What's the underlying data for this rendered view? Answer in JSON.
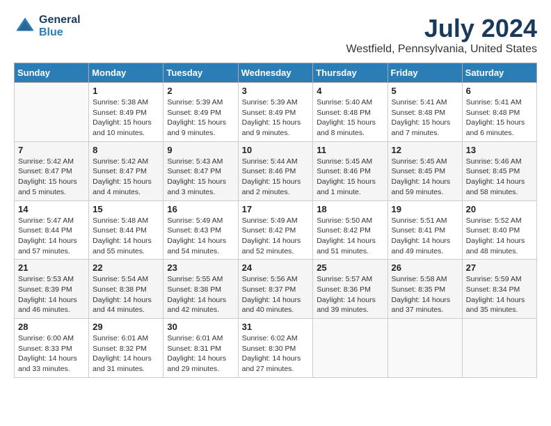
{
  "header": {
    "logo_line1": "General",
    "logo_line2": "Blue",
    "month": "July 2024",
    "location": "Westfield, Pennsylvania, United States"
  },
  "weekdays": [
    "Sunday",
    "Monday",
    "Tuesday",
    "Wednesday",
    "Thursday",
    "Friday",
    "Saturday"
  ],
  "weeks": [
    [
      {
        "day": "",
        "info": ""
      },
      {
        "day": "1",
        "info": "Sunrise: 5:38 AM\nSunset: 8:49 PM\nDaylight: 15 hours\nand 10 minutes."
      },
      {
        "day": "2",
        "info": "Sunrise: 5:39 AM\nSunset: 8:49 PM\nDaylight: 15 hours\nand 9 minutes."
      },
      {
        "day": "3",
        "info": "Sunrise: 5:39 AM\nSunset: 8:49 PM\nDaylight: 15 hours\nand 9 minutes."
      },
      {
        "day": "4",
        "info": "Sunrise: 5:40 AM\nSunset: 8:48 PM\nDaylight: 15 hours\nand 8 minutes."
      },
      {
        "day": "5",
        "info": "Sunrise: 5:41 AM\nSunset: 8:48 PM\nDaylight: 15 hours\nand 7 minutes."
      },
      {
        "day": "6",
        "info": "Sunrise: 5:41 AM\nSunset: 8:48 PM\nDaylight: 15 hours\nand 6 minutes."
      }
    ],
    [
      {
        "day": "7",
        "info": "Sunrise: 5:42 AM\nSunset: 8:47 PM\nDaylight: 15 hours\nand 5 minutes."
      },
      {
        "day": "8",
        "info": "Sunrise: 5:42 AM\nSunset: 8:47 PM\nDaylight: 15 hours\nand 4 minutes."
      },
      {
        "day": "9",
        "info": "Sunrise: 5:43 AM\nSunset: 8:47 PM\nDaylight: 15 hours\nand 3 minutes."
      },
      {
        "day": "10",
        "info": "Sunrise: 5:44 AM\nSunset: 8:46 PM\nDaylight: 15 hours\nand 2 minutes."
      },
      {
        "day": "11",
        "info": "Sunrise: 5:45 AM\nSunset: 8:46 PM\nDaylight: 15 hours\nand 1 minute."
      },
      {
        "day": "12",
        "info": "Sunrise: 5:45 AM\nSunset: 8:45 PM\nDaylight: 14 hours\nand 59 minutes."
      },
      {
        "day": "13",
        "info": "Sunrise: 5:46 AM\nSunset: 8:45 PM\nDaylight: 14 hours\nand 58 minutes."
      }
    ],
    [
      {
        "day": "14",
        "info": "Sunrise: 5:47 AM\nSunset: 8:44 PM\nDaylight: 14 hours\nand 57 minutes."
      },
      {
        "day": "15",
        "info": "Sunrise: 5:48 AM\nSunset: 8:44 PM\nDaylight: 14 hours\nand 55 minutes."
      },
      {
        "day": "16",
        "info": "Sunrise: 5:49 AM\nSunset: 8:43 PM\nDaylight: 14 hours\nand 54 minutes."
      },
      {
        "day": "17",
        "info": "Sunrise: 5:49 AM\nSunset: 8:42 PM\nDaylight: 14 hours\nand 52 minutes."
      },
      {
        "day": "18",
        "info": "Sunrise: 5:50 AM\nSunset: 8:42 PM\nDaylight: 14 hours\nand 51 minutes."
      },
      {
        "day": "19",
        "info": "Sunrise: 5:51 AM\nSunset: 8:41 PM\nDaylight: 14 hours\nand 49 minutes."
      },
      {
        "day": "20",
        "info": "Sunrise: 5:52 AM\nSunset: 8:40 PM\nDaylight: 14 hours\nand 48 minutes."
      }
    ],
    [
      {
        "day": "21",
        "info": "Sunrise: 5:53 AM\nSunset: 8:39 PM\nDaylight: 14 hours\nand 46 minutes."
      },
      {
        "day": "22",
        "info": "Sunrise: 5:54 AM\nSunset: 8:38 PM\nDaylight: 14 hours\nand 44 minutes."
      },
      {
        "day": "23",
        "info": "Sunrise: 5:55 AM\nSunset: 8:38 PM\nDaylight: 14 hours\nand 42 minutes."
      },
      {
        "day": "24",
        "info": "Sunrise: 5:56 AM\nSunset: 8:37 PM\nDaylight: 14 hours\nand 40 minutes."
      },
      {
        "day": "25",
        "info": "Sunrise: 5:57 AM\nSunset: 8:36 PM\nDaylight: 14 hours\nand 39 minutes."
      },
      {
        "day": "26",
        "info": "Sunrise: 5:58 AM\nSunset: 8:35 PM\nDaylight: 14 hours\nand 37 minutes."
      },
      {
        "day": "27",
        "info": "Sunrise: 5:59 AM\nSunset: 8:34 PM\nDaylight: 14 hours\nand 35 minutes."
      }
    ],
    [
      {
        "day": "28",
        "info": "Sunrise: 6:00 AM\nSunset: 8:33 PM\nDaylight: 14 hours\nand 33 minutes."
      },
      {
        "day": "29",
        "info": "Sunrise: 6:01 AM\nSunset: 8:32 PM\nDaylight: 14 hours\nand 31 minutes."
      },
      {
        "day": "30",
        "info": "Sunrise: 6:01 AM\nSunset: 8:31 PM\nDaylight: 14 hours\nand 29 minutes."
      },
      {
        "day": "31",
        "info": "Sunrise: 6:02 AM\nSunset: 8:30 PM\nDaylight: 14 hours\nand 27 minutes."
      },
      {
        "day": "",
        "info": ""
      },
      {
        "day": "",
        "info": ""
      },
      {
        "day": "",
        "info": ""
      }
    ]
  ]
}
